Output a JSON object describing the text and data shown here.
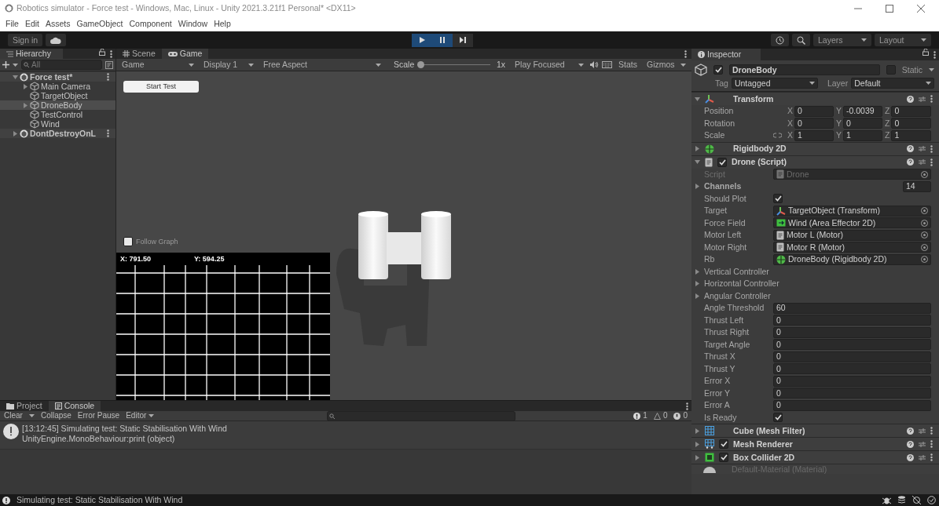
{
  "window": {
    "title": "Robotics simulator - Force test - Windows, Mac, Linux - Unity 2021.3.21f1 Personal* <DX11>"
  },
  "menu": [
    "File",
    "Edit",
    "Assets",
    "GameObject",
    "Component",
    "Window",
    "Help"
  ],
  "toolbar": {
    "sign_in": "Sign in",
    "play_controls": [
      {
        "kind": "play",
        "on": true
      },
      {
        "kind": "pause",
        "on": true
      },
      {
        "kind": "step",
        "on": false
      }
    ],
    "layers": "Layers",
    "layout": "Layout"
  },
  "hierarchy": {
    "tab": "Hierarchy",
    "placeholder": "All",
    "tree": [
      {
        "name": "Force test*",
        "kind": "scene",
        "expanded": true,
        "selected": false,
        "children": [
          {
            "name": "Main Camera",
            "kind": "object",
            "expanded": false,
            "selected": false
          },
          {
            "name": "TargetObject",
            "kind": "object",
            "selected": false
          },
          {
            "name": "DroneBody",
            "kind": "object",
            "expanded": false,
            "selected": true
          },
          {
            "name": "TestControl",
            "kind": "object",
            "selected": false
          },
          {
            "name": "Wind",
            "kind": "object",
            "selected": false
          }
        ]
      },
      {
        "name": "DontDestroyOnL",
        "kind": "scene",
        "expanded": false,
        "selected": false
      }
    ]
  },
  "view_tabs": [
    {
      "label": "Scene",
      "kind": "scene",
      "selected": false
    },
    {
      "label": "Game",
      "kind": "game",
      "selected": true
    }
  ],
  "game_toolbar": {
    "mode": "Game",
    "display": "Display 1",
    "aspect": "Free Aspect",
    "scale_label": "Scale",
    "scale": {
      "level": 0
    },
    "scale_reading": "1x",
    "play_focused": "Play Focused",
    "stats": "Stats",
    "gizmos": "Gizmos"
  },
  "game_view": {
    "start_button": "Start Test",
    "follow_graph": {
      "label": "Follow Graph",
      "checked": false
    },
    "graph": {
      "x_reading": "X: 791.50",
      "y_reading": "Y: 594.25"
    }
  },
  "inspector": {
    "tab": "Inspector",
    "object": {
      "active": true,
      "name": "DroneBody",
      "static": false,
      "static_label": "Static",
      "tag_label": "Tag",
      "tag": "Untagged",
      "layer_label": "Layer",
      "layer": "Default"
    },
    "components": [
      {
        "name": "Transform",
        "kind": "transform",
        "expanded": true,
        "fields": [
          {
            "kind": "vector",
            "label": "Position",
            "values": [
              {
                "axis": "X",
                "value": "0"
              },
              {
                "axis": "Y",
                "value": "-0.0039"
              },
              {
                "axis": "Z",
                "value": "0"
              }
            ]
          },
          {
            "kind": "vector",
            "label": "Rotation",
            "values": [
              {
                "axis": "X",
                "value": "0"
              },
              {
                "axis": "Y",
                "value": "0"
              },
              {
                "axis": "Z",
                "value": "0"
              }
            ]
          },
          {
            "kind": "vector",
            "label": "Scale",
            "linked": true,
            "values": [
              {
                "axis": "X",
                "value": "1"
              },
              {
                "axis": "Y",
                "value": "1"
              },
              {
                "axis": "Z",
                "value": "1"
              }
            ]
          }
        ]
      },
      {
        "name": "Rigidbody 2D",
        "kind": "rigidbody",
        "expanded": false
      },
      {
        "name": "Drone (Script)",
        "kind": "script",
        "expanded": true,
        "enabled": true,
        "fields": [
          {
            "kind": "source",
            "label": "Script",
            "value": "Drone",
            "disabled": true
          },
          {
            "kind": "array",
            "label": "Channels",
            "expanded": false,
            "value": "14"
          },
          {
            "kind": "checkbox",
            "label": "Should Plot",
            "checked": true
          },
          {
            "kind": "transform",
            "label": "Target",
            "value": "TargetObject (Transform)"
          },
          {
            "kind": "effector",
            "label": "Force Field",
            "value": "Wind (Area Effector 2D)"
          },
          {
            "kind": "component",
            "label": "Motor Left",
            "value": "Motor L (Motor)"
          },
          {
            "kind": "component",
            "label": "Motor Right",
            "value": "Motor R (Motor)"
          },
          {
            "kind": "rigidbody",
            "label": "Rb",
            "value": "DroneBody (Rigidbody 2D)"
          },
          {
            "kind": "foldout",
            "label": "Vertical Controller",
            "expanded": false
          },
          {
            "kind": "foldout",
            "label": "Horizontal Controller",
            "expanded": false
          },
          {
            "kind": "foldout",
            "label": "Angular Controller",
            "expanded": false
          },
          {
            "kind": "number",
            "label": "Angle Threshold",
            "value": "60"
          },
          {
            "kind": "number",
            "label": "Thrust Left",
            "value": "0"
          },
          {
            "kind": "number",
            "label": "Thrust Right",
            "value": "0"
          },
          {
            "kind": "number",
            "label": "Target Angle",
            "value": "0"
          },
          {
            "kind": "number",
            "label": "Thrust X",
            "value": "0"
          },
          {
            "kind": "number",
            "label": "Thrust Y",
            "value": "0"
          },
          {
            "kind": "number",
            "label": "Error X",
            "value": "0"
          },
          {
            "kind": "number",
            "label": "Error Y",
            "value": "0"
          },
          {
            "kind": "number",
            "label": "Error A",
            "value": "0"
          },
          {
            "kind": "checkbox",
            "label": "Is Ready",
            "checked": true
          }
        ]
      },
      {
        "name": "Cube (Mesh Filter)",
        "kind": "meshfilter",
        "expanded": false
      },
      {
        "name": "Mesh Renderer",
        "kind": "meshrenderer",
        "expanded": false,
        "enabled": true
      },
      {
        "name": "Box Collider 2D",
        "kind": "boxcollider",
        "expanded": false,
        "enabled": true
      },
      {
        "name": "Default-Material (Material)",
        "kind": "material"
      }
    ]
  },
  "console": {
    "tabs": [
      {
        "label": "Project",
        "kind": "project",
        "selected": false
      },
      {
        "label": "Console",
        "kind": "console",
        "selected": true
      }
    ],
    "clear": "Clear",
    "collapse": "Collapse",
    "error_pause": "Error Pause",
    "editor": "Editor",
    "counts": [
      {
        "kind": "info",
        "count": "1"
      },
      {
        "kind": "warning",
        "count": "0"
      },
      {
        "kind": "error",
        "count": "0"
      }
    ],
    "entries": [
      {
        "kind": "info",
        "message": "[13:12:45] Simulating test: Static Stabilisation With Wind",
        "trace": "UnityEngine.MonoBehaviour:print (object)"
      }
    ]
  },
  "status_bar": {
    "kind": "info",
    "message": "Simulating test: Static Stabilisation With Wind"
  }
}
